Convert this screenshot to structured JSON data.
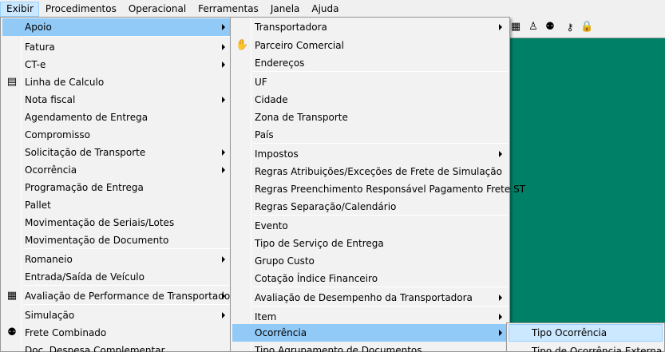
{
  "menubar": {
    "items": [
      "Exibir",
      "Procedimentos",
      "Operacional",
      "Ferramentas",
      "Janela",
      "Ajuda"
    ]
  },
  "menu_exibir": {
    "items": [
      {
        "label": "Apoio",
        "submenu": true
      },
      {
        "label": "Fatura",
        "submenu": true
      },
      {
        "label": "CT-e",
        "submenu": true
      },
      {
        "label": "Linha de Calculo",
        "submenu": false,
        "icon": "calculator-icon"
      },
      {
        "label": "Nota fiscal",
        "submenu": true
      },
      {
        "label": "Agendamento de Entrega",
        "submenu": false
      },
      {
        "label": "Compromisso",
        "submenu": false
      },
      {
        "label": "Solicitação de Transporte",
        "submenu": true
      },
      {
        "label": "Ocorrência",
        "submenu": true
      },
      {
        "label": "Programação de Entrega",
        "submenu": false
      },
      {
        "label": "Pallet",
        "submenu": false
      },
      {
        "label": "Movimentação de Seriais/Lotes",
        "submenu": false
      },
      {
        "label": "Movimentação de Documento",
        "submenu": false
      },
      {
        "label": "Romaneio",
        "submenu": true
      },
      {
        "label": "Entrada/Saída de Veículo",
        "submenu": false
      },
      {
        "label": "Avaliação de Performance de Transportadora",
        "submenu": true,
        "icon": "chart-icon"
      },
      {
        "label": "Simulação",
        "submenu": true
      },
      {
        "label": "Frete Combinado",
        "submenu": false,
        "icon": "people-icon"
      },
      {
        "label": "Doc. Despesa Complementar",
        "submenu": false
      }
    ]
  },
  "menu_apoio": {
    "items": [
      {
        "label": "Transportadora",
        "submenu": true
      },
      {
        "label": "Parceiro Comercial",
        "submenu": false,
        "icon": "handshake-icon"
      },
      {
        "label": "Endereços",
        "submenu": false
      },
      {
        "label": "UF",
        "submenu": false
      },
      {
        "label": "Cidade",
        "submenu": false
      },
      {
        "label": "Zona de Transporte",
        "submenu": false
      },
      {
        "label": "País",
        "submenu": false
      },
      {
        "label": "Impostos",
        "submenu": true
      },
      {
        "label": "Regras Atribuições/Exceções de Frete de Simulação",
        "submenu": false
      },
      {
        "label": "Regras Preenchimento Responsável Pagamento Frete ST",
        "submenu": false
      },
      {
        "label": "Regras Separação/Calendário",
        "submenu": false
      },
      {
        "label": "Evento",
        "submenu": false
      },
      {
        "label": "Tipo de Serviço de Entrega",
        "submenu": false
      },
      {
        "label": "Grupo Custo",
        "submenu": false
      },
      {
        "label": "Cotação Índice Financeiro",
        "submenu": false
      },
      {
        "label": "Avaliação de Desempenho da Transportadora",
        "submenu": true
      },
      {
        "label": "Item",
        "submenu": true
      },
      {
        "label": "Ocorrência",
        "submenu": true
      },
      {
        "label": "Tipo Agrupamento de Documentos",
        "submenu": false
      }
    ]
  },
  "menu_ocorrencia": {
    "items": [
      {
        "label": "Tipo Ocorrência"
      },
      {
        "label": "Tipo de Ocorrência Externa"
      }
    ]
  },
  "toolbar": {
    "icons": [
      "grid-icon",
      "person-icon",
      "people-icon",
      "key-icon",
      "lock-icon"
    ]
  },
  "colors": {
    "workspace": "#008066",
    "menu_highlight": "#91c9f7",
    "menubar_active": "#cce8ff"
  }
}
